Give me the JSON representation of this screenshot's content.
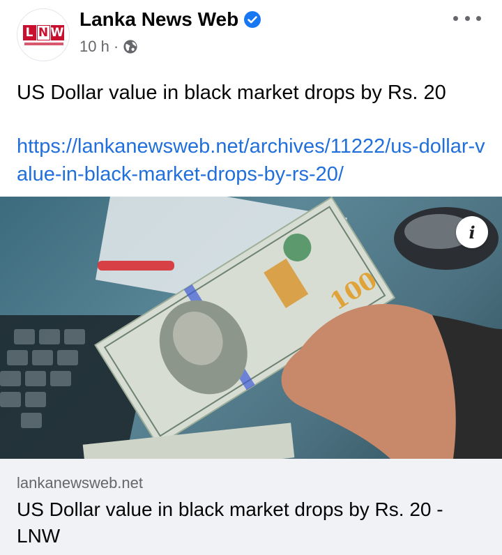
{
  "post": {
    "page_name": "Lanka News Web",
    "avatar_text": "LNW",
    "avatar_letters": [
      "L",
      "N",
      "W"
    ],
    "time": "10 h",
    "separator": "·",
    "text": "US Dollar value in black market drops by Rs. 20",
    "link_text": "https://lankanewsweb.net/archives/11222/us-dollar-value-in-black-market-drops-by-rs-20/",
    "more_icon": "more-horizontal-icon",
    "verified_icon": "verified-badge-icon",
    "privacy_icon": "globe-icon"
  },
  "image": {
    "info_label": "i",
    "banknote_denomination": "100"
  },
  "link_card": {
    "domain": "lankanewsweb.net",
    "title": "US Dollar value in black market drops by Rs. 20 - LNW"
  },
  "colors": {
    "link": "#216fdb",
    "verified": "#1877f2",
    "secondary_text": "#65676b",
    "card_bg": "#f0f2f5",
    "brand_red": "#c8102e"
  }
}
